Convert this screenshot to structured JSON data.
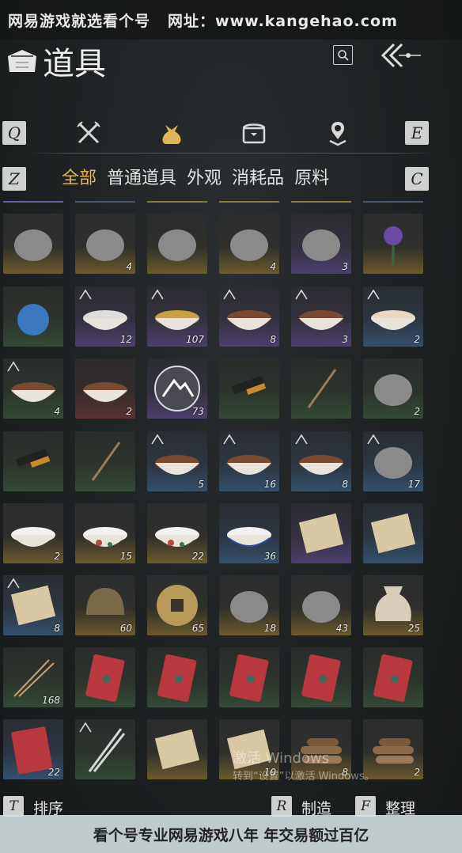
{
  "watermark": {
    "top_left": "网易游戏就选看个号",
    "top_right": "网址：www.kangehao.com",
    "bottom": "看个号专业网易游戏八年 年交易额过百亿"
  },
  "header": {
    "title": "道具"
  },
  "keys": {
    "prev_tab": "Q",
    "next_tab": "E",
    "prev_subtab": "Z",
    "next_subtab": "C"
  },
  "tabs": [
    "weapons-icon",
    "bag-icon",
    "chest-icon",
    "map-pin-icon"
  ],
  "active_tab": 1,
  "subtabs": [
    "全部",
    "普通道具",
    "外观",
    "消耗品",
    "原料"
  ],
  "active_subtab": 0,
  "colors": {
    "active_accent": "#e0b458",
    "key_bg": "#cfd0d0"
  },
  "items": [
    {
      "icon": "silk-cocoon-icon",
      "rarity": "gold",
      "count": ""
    },
    {
      "icon": "stone-egg-icon",
      "rarity": "gold",
      "count": "4"
    },
    {
      "icon": "cricket-icon",
      "rarity": "gold",
      "count": ""
    },
    {
      "icon": "firefly-icon",
      "rarity": "gold",
      "count": "4"
    },
    {
      "icon": "dragonfly-icon",
      "rarity": "purple",
      "count": "3"
    },
    {
      "icon": "purple-flower-icon",
      "rarity": "gold",
      "count": ""
    },
    {
      "icon": "blue-pouch-icon",
      "rarity": "green",
      "count": ""
    },
    {
      "icon": "rice-porridge-icon",
      "rarity": "purple",
      "count": "12",
      "badge": "sparkle"
    },
    {
      "icon": "golden-soup-icon",
      "rarity": "purple",
      "count": "107",
      "badge": "corner"
    },
    {
      "icon": "stew-bowl-icon",
      "rarity": "purple",
      "count": "8",
      "badge": "sparkle"
    },
    {
      "icon": "meat-bowl-icon",
      "rarity": "purple",
      "count": "3",
      "badge": "sparkle"
    },
    {
      "icon": "egg-soup-icon",
      "rarity": "blue",
      "count": "2",
      "badge": "sparkle"
    },
    {
      "icon": "vegetable-plate-icon",
      "rarity": "green",
      "count": "4",
      "badge": "sparkle"
    },
    {
      "icon": "braised-dish-icon",
      "rarity": "red",
      "count": "2"
    },
    {
      "icon": "mountain-emblem-icon",
      "rarity": "purple",
      "count": "73"
    },
    {
      "icon": "ink-stick-icon",
      "rarity": "green",
      "count": ""
    },
    {
      "icon": "wooden-stick-icon",
      "rarity": "green",
      "count": ""
    },
    {
      "icon": "mountain-tray-icon",
      "rarity": "green",
      "count": "2"
    },
    {
      "icon": "ink-stick-icon",
      "rarity": "green",
      "count": ""
    },
    {
      "icon": "wooden-stick-icon",
      "rarity": "green",
      "count": ""
    },
    {
      "icon": "sliced-meat-icon",
      "rarity": "blue",
      "count": "5",
      "badge": "peak"
    },
    {
      "icon": "mixed-plate-icon",
      "rarity": "blue",
      "count": "16",
      "badge": "peak"
    },
    {
      "icon": "berry-bowl-icon",
      "rarity": "blue",
      "count": "8",
      "badge": "peak"
    },
    {
      "icon": "clay-pot-icon",
      "rarity": "blue",
      "count": "17",
      "badge": "peak"
    },
    {
      "icon": "white-bowl-icon",
      "rarity": "gold",
      "count": "2"
    },
    {
      "icon": "painted-bowl-icon",
      "rarity": "gold",
      "count": "15"
    },
    {
      "icon": "rooster-bowl-icon",
      "rarity": "gold",
      "count": "22"
    },
    {
      "icon": "blue-rim-bowl-icon",
      "rarity": "blue",
      "count": "36"
    },
    {
      "icon": "map-scroll-icon",
      "rarity": "purple",
      "count": ""
    },
    {
      "icon": "map-scroll-icon",
      "rarity": "blue",
      "count": ""
    },
    {
      "icon": "letter-icon",
      "rarity": "blue",
      "count": "8",
      "badge": "paper"
    },
    {
      "icon": "bronze-helmet-icon",
      "rarity": "gold",
      "count": "60"
    },
    {
      "icon": "coin-icon",
      "rarity": "gold",
      "count": "65"
    },
    {
      "icon": "herb-powder-icon",
      "rarity": "gold",
      "count": "18"
    },
    {
      "icon": "worm-icon",
      "rarity": "gold",
      "count": "43"
    },
    {
      "icon": "sack-icon",
      "rarity": "gold",
      "count": "25"
    },
    {
      "icon": "arrows-icon",
      "rarity": "green",
      "count": "168"
    },
    {
      "icon": "red-envelope-icon",
      "rarity": "green",
      "count": ""
    },
    {
      "icon": "red-envelope-icon",
      "rarity": "green",
      "count": ""
    },
    {
      "icon": "red-envelope-icon",
      "rarity": "green",
      "count": ""
    },
    {
      "icon": "red-envelope-icon",
      "rarity": "green",
      "count": ""
    },
    {
      "icon": "red-envelope-icon",
      "rarity": "green",
      "count": ""
    },
    {
      "icon": "red-book-icon",
      "rarity": "blue",
      "count": "22"
    },
    {
      "icon": "twin-swords-icon",
      "rarity": "green",
      "count": "",
      "badge": "shrine"
    },
    {
      "icon": "scroll-painting-icon",
      "rarity": "gold",
      "count": ""
    },
    {
      "icon": "paper-scroll-icon",
      "rarity": "gold",
      "count": "10"
    },
    {
      "icon": "firewood-icon",
      "rarity": "gold",
      "count": "8"
    },
    {
      "icon": "firewood-icon",
      "rarity": "gold",
      "count": "2"
    }
  ],
  "overlay": {
    "title": "激活 Windows",
    "hint": "转到“设置”以激活 Windows。"
  },
  "actions": {
    "sort": {
      "key": "T",
      "label": "排序"
    },
    "craft": {
      "key": "R",
      "label": "制造"
    },
    "organize": {
      "key": "F",
      "label": "整理"
    }
  }
}
